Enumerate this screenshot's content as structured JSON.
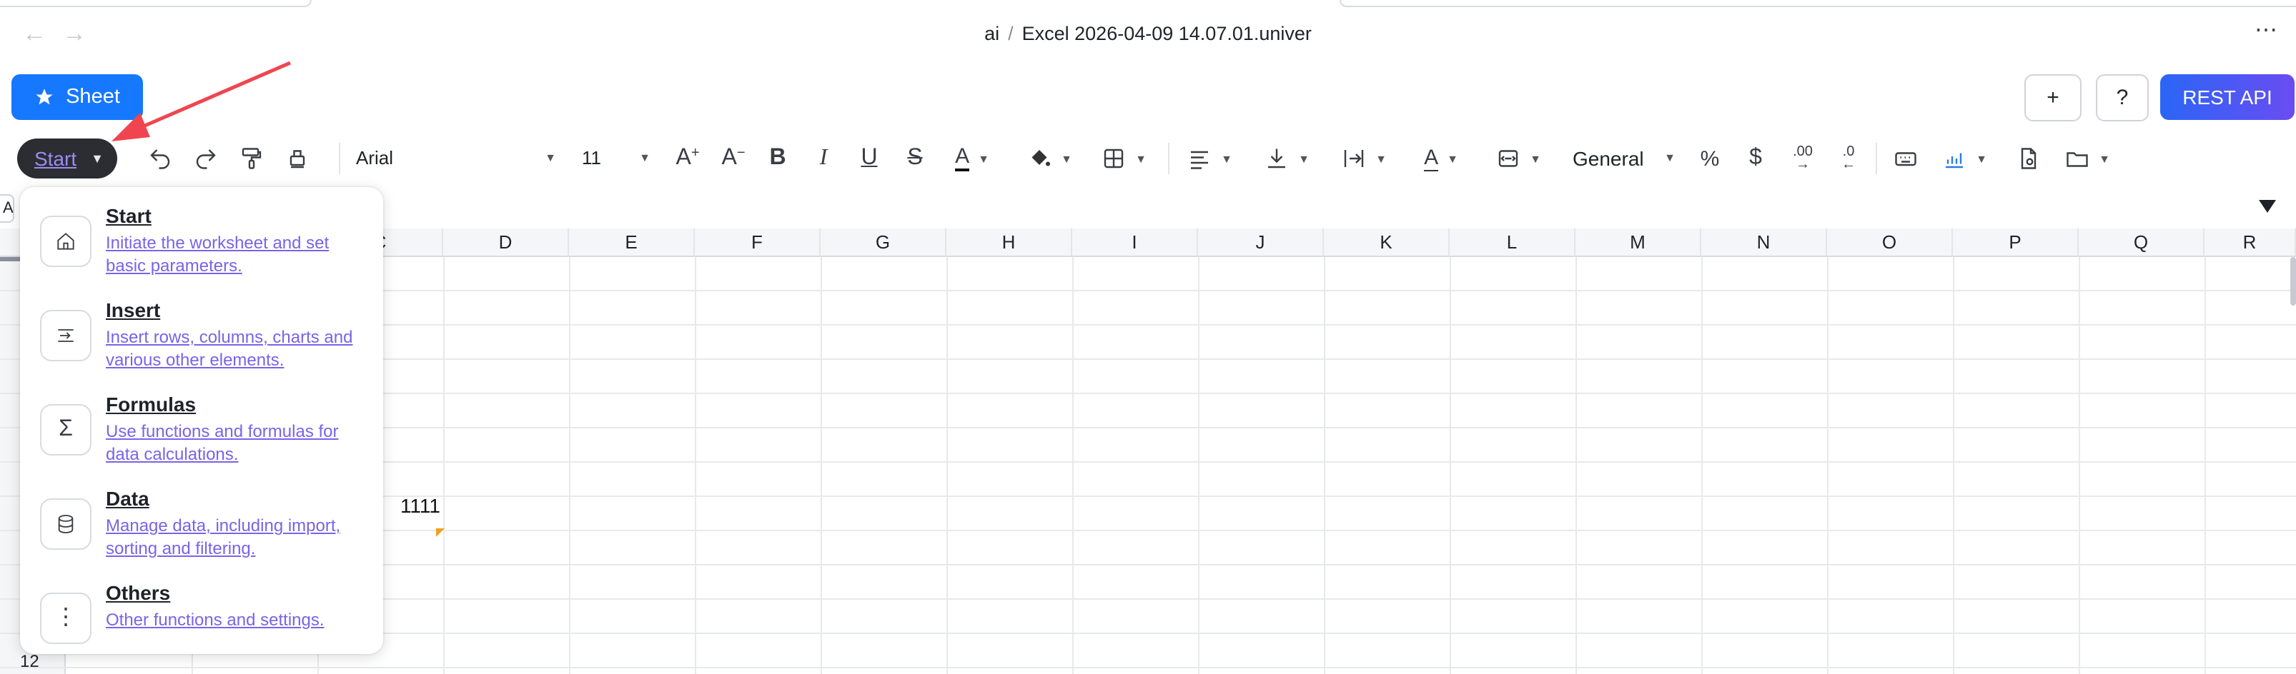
{
  "window": {
    "breadcrumb_root": "ai",
    "breadcrumb_sep": "/",
    "file_name": "Excel 2026-04-09 14.07.01.univer",
    "more": "⋯"
  },
  "nav": {
    "back": "←",
    "forward": "→"
  },
  "header": {
    "sheet_button": "Sheet",
    "plus_button": "+",
    "help_button": "?",
    "rest_api_button": "REST API"
  },
  "toolbar": {
    "start_tab": "Start",
    "font_name": "Arial",
    "font_size": "11",
    "number_format": "General"
  },
  "namebox": {
    "value": "A"
  },
  "columns": [
    "C",
    "D",
    "E",
    "F",
    "G",
    "H",
    "I",
    "J",
    "K",
    "L",
    "M",
    "N",
    "O",
    "P",
    "Q",
    "R"
  ],
  "rows": {
    "last_visible": "12"
  },
  "cells": {
    "c_value": "1111"
  },
  "menu": {
    "items": [
      {
        "title": "Start",
        "desc": "Initiate the worksheet and set basic parameters."
      },
      {
        "title": "Insert",
        "desc": "Insert rows, columns, charts and various other elements."
      },
      {
        "title": "Formulas",
        "desc": "Use functions and formulas for data calculations."
      },
      {
        "title": "Data",
        "desc": "Manage data, including import, sorting and filtering."
      },
      {
        "title": "Others",
        "desc": "Other functions and settings."
      }
    ]
  },
  "colors": {
    "accent": "#1677ff",
    "rest_grad_start": "#2a66f6",
    "rest_grad_end": "#6a4cf2",
    "annotation_arrow": "#f0454f",
    "menu_link": "#7a63e8"
  }
}
